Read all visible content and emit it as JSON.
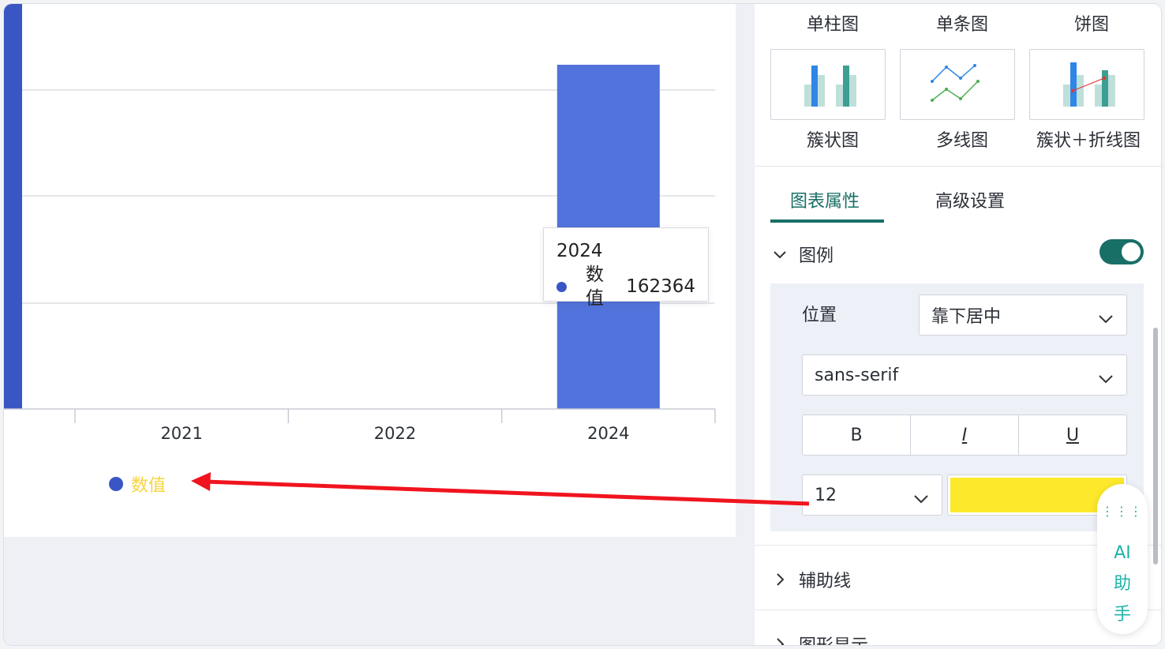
{
  "chart": {
    "tooltip": {
      "title": "2024",
      "series_name": "数值",
      "value": "162364"
    },
    "legend_label": "数值",
    "legend_color": "#f7d43c",
    "bar_color": "#5273db",
    "dot_color": "#3a56c5"
  },
  "chart_data": {
    "type": "bar",
    "categories": [
      "2021",
      "2022",
      "2024"
    ],
    "series": [
      {
        "name": "数值",
        "values": [
          null,
          null,
          162364
        ]
      }
    ],
    "legend_placement": "bottom-left",
    "grid": true
  },
  "side": {
    "chart_types_top": [
      "单柱图",
      "单条图",
      "饼图"
    ],
    "chart_types": [
      {
        "label": "簇状图",
        "icon": "clustered-bar-icon"
      },
      {
        "label": "多线图",
        "icon": "multi-line-icon"
      },
      {
        "label": "簇状＋折线图",
        "icon": "bar-line-combo-icon"
      }
    ],
    "tabs": [
      "图表属性",
      "高级设置"
    ],
    "legend_section": {
      "title": "图例",
      "enabled": true,
      "position_label": "位置",
      "position_value": "靠下居中",
      "font_family": "sans-serif",
      "bold": "B",
      "italic": "I",
      "underline": "U",
      "font_size": "12",
      "font_color": "#fde82b"
    },
    "sections": [
      "辅助线",
      "图形显示"
    ],
    "ai_assistant": "AI助手"
  },
  "accent_color": "#186f66"
}
